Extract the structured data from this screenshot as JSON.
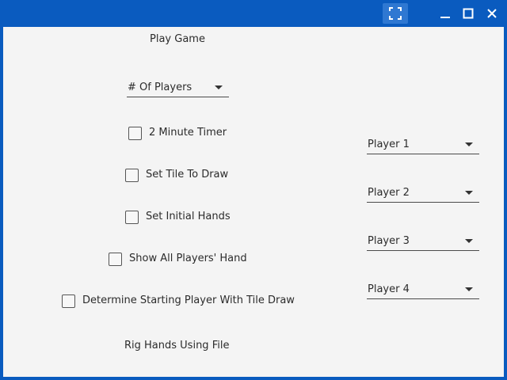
{
  "menu": {
    "play_game": "Play Game",
    "rig_hands": "Rig Hands Using File"
  },
  "players_combo": {
    "label": "# Of Players"
  },
  "options": [
    {
      "label": "2 Minute Timer",
      "checked": false
    },
    {
      "label": "Set Tile To Draw",
      "checked": false
    },
    {
      "label": "Set Initial Hands",
      "checked": false
    },
    {
      "label": "Show All Players' Hand",
      "checked": false
    },
    {
      "label": "Determine Starting Player With Tile Draw",
      "checked": false
    }
  ],
  "player_selects": [
    {
      "label": "Player 1"
    },
    {
      "label": "Player 2"
    },
    {
      "label": "Player 3"
    },
    {
      "label": "Player 4"
    }
  ],
  "icons": {
    "fullscreen": "fullscreen-icon",
    "minimize": "minimize-icon",
    "maximize": "maximize-icon",
    "close": "close-icon"
  },
  "colors": {
    "titlebar": "#0a5bbf",
    "background": "#f4f4f4"
  }
}
